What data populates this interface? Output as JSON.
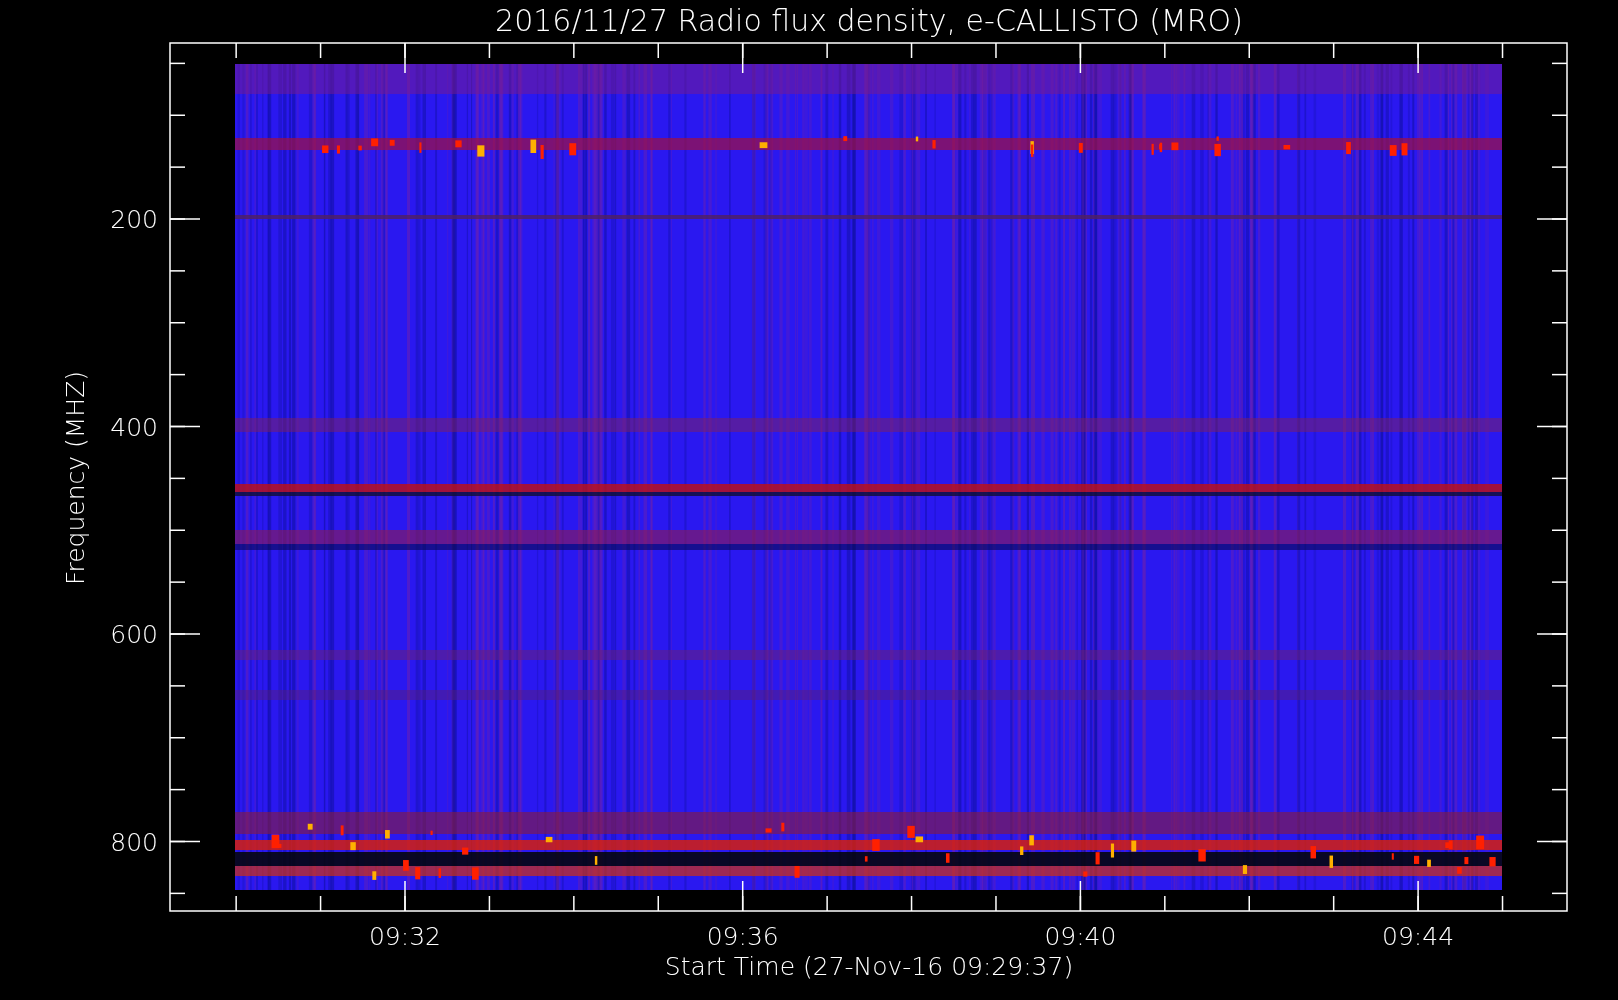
{
  "plot": {
    "title": "2016/11/27  Radio flux density, e-CALLISTO (MRO)",
    "ylabel": "Frequency (MHZ)",
    "xlabel": "Start Time (27-Nov-16 09:29:37)",
    "yticks": [
      "200",
      "400",
      "600",
      "800"
    ],
    "xticks": [
      "09:32",
      "09:36",
      "09:40",
      "09:44"
    ]
  }
}
